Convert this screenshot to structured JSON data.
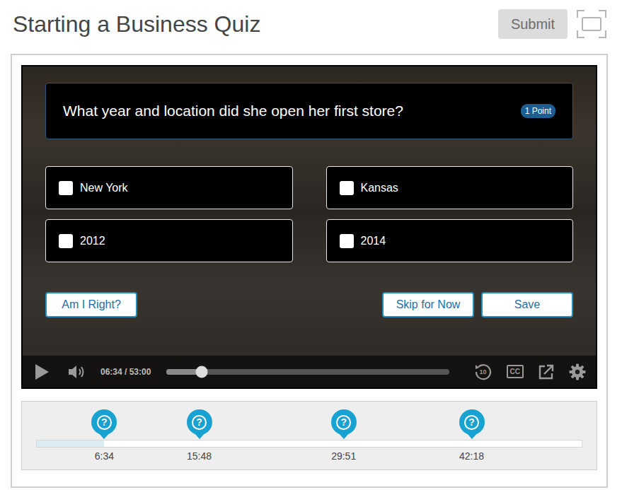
{
  "title": "Starting a Business Quiz",
  "submit": {
    "label": "Submit",
    "disabled": true
  },
  "question": {
    "text": "What year and location did she open her first store?",
    "points": "1 Point"
  },
  "options": [
    {
      "label": "New York",
      "checked": false
    },
    {
      "label": "Kansas",
      "checked": false
    },
    {
      "label": "2012",
      "checked": false
    },
    {
      "label": "2014",
      "checked": false
    }
  ],
  "actions": {
    "left": [
      "Am I Right?"
    ],
    "right": [
      "Skip for Now",
      "Save"
    ]
  },
  "player": {
    "time": "06:34 / 53:00",
    "playing": false,
    "level": 0.124,
    "replay": "10",
    "cc": "CC"
  },
  "timeline": {
    "level": 0.124,
    "markers": [
      {
        "time": "6:34",
        "icon": "?"
      },
      {
        "time": "15:48",
        "icon": "?"
      },
      {
        "time": "29:51",
        "icon": "?"
      },
      {
        "time": "42:18",
        "icon": "?"
      }
    ]
  }
}
